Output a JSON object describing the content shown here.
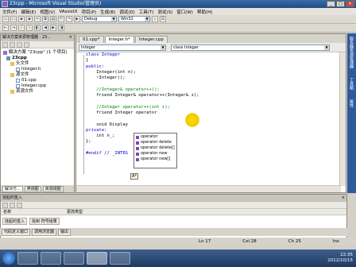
{
  "window": {
    "title": "23cpp - Microsoft Visual Studio(管理员)"
  },
  "menu": [
    "文件(F)",
    "编辑(E)",
    "视图(V)",
    "VAssistX",
    "项目(P)",
    "生成(B)",
    "调试(D)",
    "工具(T)",
    "测试(S)",
    "窗口(W)",
    "帮助(H)"
  ],
  "toolbar": {
    "config": "Debug",
    "platform": "Win32"
  },
  "solution_panel": {
    "title": "解决方案资源管理器 - 23...",
    "items": [
      {
        "label": "解决方案 \"23cpp\" (1 个项目)",
        "level": 0,
        "icon": "solution-icon"
      },
      {
        "label": "23cpp",
        "level": 1,
        "icon": "project-icon"
      },
      {
        "label": "头文件",
        "level": 2,
        "icon": "folder-icon"
      },
      {
        "label": "Integer.h",
        "level": 3,
        "icon": "file-icon"
      },
      {
        "label": "源文件",
        "level": 2,
        "icon": "folder-icon"
      },
      {
        "label": "01.cpp",
        "level": 3,
        "icon": "file-icon"
      },
      {
        "label": "Integer.cpp",
        "level": 3,
        "icon": "file-icon"
      },
      {
        "label": "资源文件",
        "level": 2,
        "icon": "folder-icon"
      }
    ],
    "tabs": [
      "解决方...",
      "类视图",
      "资源视图"
    ]
  },
  "editor": {
    "tabs": [
      "01.cpp*",
      "Integer.h*",
      "Integer.cpp"
    ],
    "active_tab": 1,
    "scope": "Integer",
    "member": "class Integer",
    "lines": [
      "class Integer",
      "{",
      "public:",
      "    Integer(int n);",
      "    ~Integer();",
      "",
      "    //Integer& operator++();",
      "    friend Integer& operator++(Integer& i);",
      "",
      "    //Integer operator++(int i);",
      "    friend Integer operator",
      "",
      "    void Display",
      "private:",
      "    int n_;",
      "};",
      "",
      "#endif // _INTEG"
    ]
  },
  "intellisense": {
    "items": [
      "operator",
      "operator delete",
      "operator delete[]",
      "operator new",
      "operator new[]"
    ],
    "tip": "A*"
  },
  "right_strip": [
    "服务器资源管理器",
    "工具箱",
    "属性"
  ],
  "bottom_panel": {
    "title": "挂起的签入",
    "grid_headers": [
      "名称",
      "更改类型"
    ],
    "tabs": [
      "挂起的签入",
      "找到 符号结果"
    ],
    "bottom_tabs": [
      "代码定义窗口",
      "调用浏览器",
      "输出"
    ]
  },
  "status": {
    "ln": "Ln 17",
    "col": "Col 28",
    "ch": "Ch 25",
    "mode": "Ins"
  },
  "clock": {
    "time": "22:35",
    "date": "2012/10/15"
  }
}
